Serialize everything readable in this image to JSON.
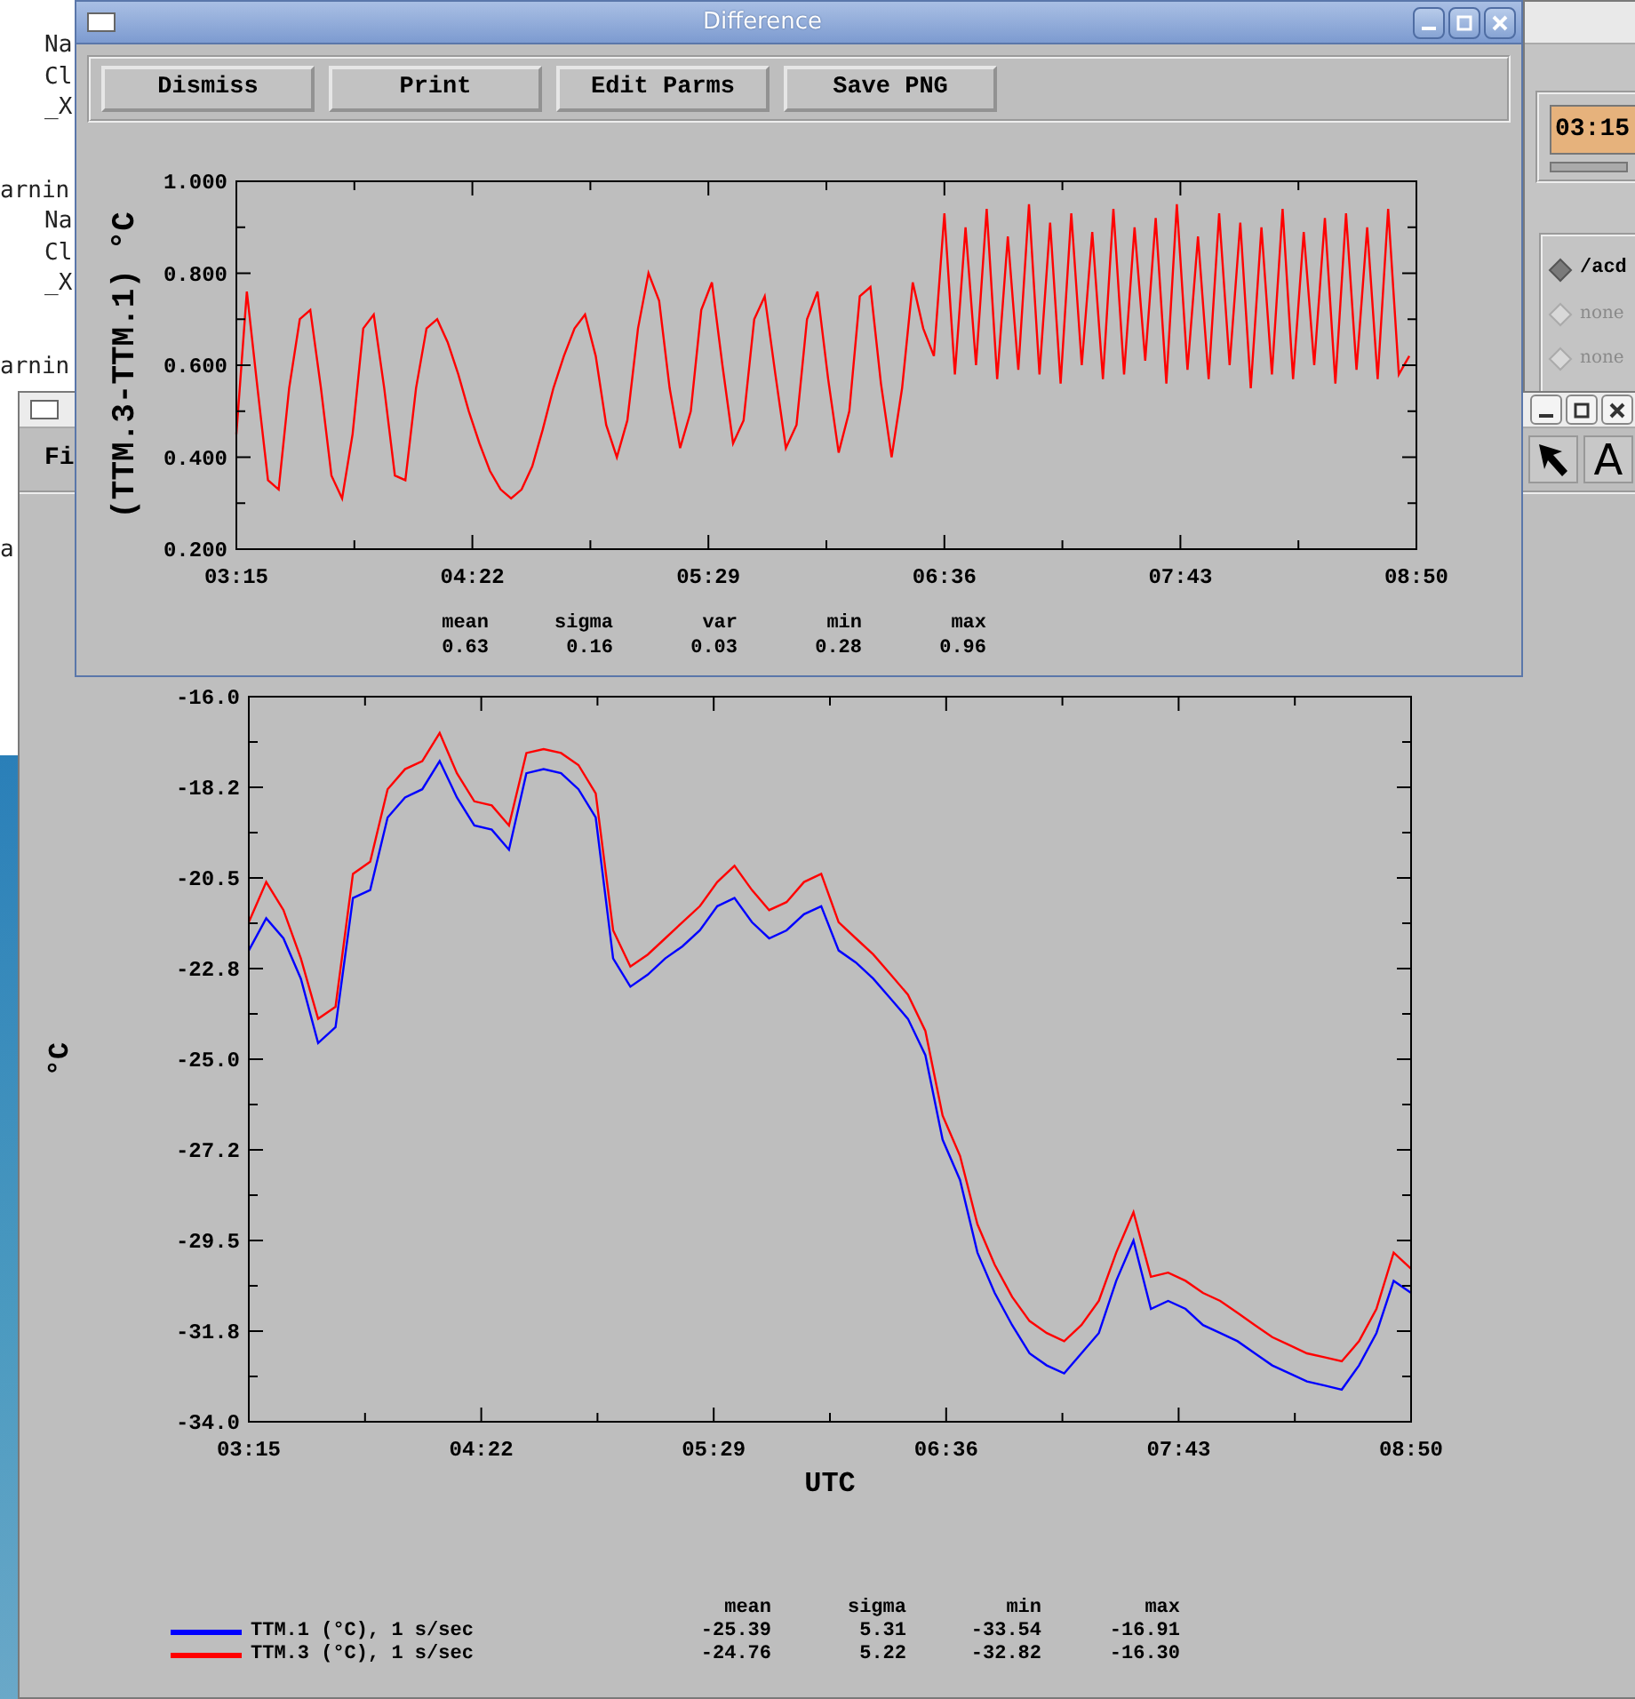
{
  "terminal": {
    "blocks": [
      {
        "lines": [
          "Na",
          "Cl",
          "_X"
        ]
      },
      {
        "heading": "arnin",
        "lines": [
          "Na",
          "Cl",
          "_X"
        ]
      },
      {
        "heading": "arnin"
      },
      {
        "heading": "a"
      }
    ]
  },
  "right_window": {
    "time_field": {
      "value": "03:15"
    },
    "radios": [
      {
        "label": "/acd",
        "selected": true
      },
      {
        "label": "none",
        "selected": false
      },
      {
        "label": "none",
        "selected": false
      }
    ]
  },
  "plot_window": {
    "menu": [
      {
        "label": "Fi"
      }
    ],
    "tools": [
      {
        "kind": "pointer"
      },
      {
        "kind": "text",
        "label": "A"
      }
    ],
    "chart_data": {
      "type": "line",
      "xlabel": "UTC",
      "ylabel": "°C",
      "x": [
        195,
        200,
        205,
        210,
        215,
        220,
        225,
        230,
        235,
        240,
        245,
        250,
        255,
        260,
        265,
        270,
        275,
        280,
        285,
        290,
        295,
        300,
        305,
        310,
        315,
        320,
        325,
        330,
        335,
        340,
        345,
        350,
        355,
        360,
        365,
        370,
        375,
        380,
        385,
        390,
        395,
        400,
        405,
        410,
        415,
        420,
        425,
        430,
        435,
        440,
        445,
        450,
        455,
        460,
        465,
        470,
        475,
        480,
        485,
        490,
        495,
        500,
        505,
        510,
        515,
        520,
        525,
        530
      ],
      "xlim": [
        195,
        530
      ],
      "ylim": [
        -34,
        -16
      ],
      "xticks": [
        {
          "value": 195,
          "label": "03:15"
        },
        {
          "value": 262,
          "label": "04:22"
        },
        {
          "value": 329,
          "label": "05:29"
        },
        {
          "value": 396,
          "label": "06:36"
        },
        {
          "value": 463,
          "label": "07:43"
        },
        {
          "value": 530,
          "label": "08:50"
        }
      ],
      "yticks": [
        {
          "value": -16,
          "label": "-16.0"
        },
        {
          "value": -18.25,
          "label": "-18.2"
        },
        {
          "value": -20.5,
          "label": "-20.5"
        },
        {
          "value": -22.75,
          "label": "-22.8"
        },
        {
          "value": -25,
          "label": "-25.0"
        },
        {
          "value": -27.25,
          "label": "-27.2"
        },
        {
          "value": -29.5,
          "label": "-29.5"
        },
        {
          "value": -31.75,
          "label": "-31.8"
        },
        {
          "value": -34,
          "label": "-34.0"
        }
      ],
      "series": [
        {
          "name": "TTM.1 (°C), 1 s/sec",
          "color": "#0000ff",
          "values": [
            -22.3,
            -21.5,
            -22.0,
            -23.0,
            -24.6,
            -24.2,
            -21.0,
            -20.8,
            -19.0,
            -18.5,
            -18.3,
            -17.6,
            -18.5,
            -19.2,
            -19.3,
            -19.8,
            -17.9,
            -17.8,
            -17.9,
            -18.3,
            -19.0,
            -22.5,
            -23.2,
            -22.9,
            -22.5,
            -22.2,
            -21.8,
            -21.2,
            -21.0,
            -21.6,
            -22.0,
            -21.8,
            -21.4,
            -21.2,
            -22.3,
            -22.6,
            -23.0,
            -23.5,
            -24.0,
            -24.9,
            -27.0,
            -28.0,
            -29.8,
            -30.8,
            -31.6,
            -32.3,
            -32.6,
            -32.8,
            -32.3,
            -31.8,
            -30.5,
            -29.5,
            -31.2,
            -31.0,
            -31.2,
            -31.6,
            -31.8,
            -32.0,
            -32.3,
            -32.6,
            -32.8,
            -33.0,
            -33.1,
            -33.2,
            -32.6,
            -31.8,
            -30.5,
            -30.8
          ]
        },
        {
          "name": "TTM.3 (°C), 1 s/sec",
          "color": "#ff0000",
          "values": [
            -21.6,
            -20.6,
            -21.3,
            -22.5,
            -24.0,
            -23.7,
            -20.4,
            -20.1,
            -18.3,
            -17.8,
            -17.6,
            -16.9,
            -17.9,
            -18.6,
            -18.7,
            -19.2,
            -17.4,
            -17.3,
            -17.4,
            -17.7,
            -18.4,
            -21.8,
            -22.7,
            -22.4,
            -22.0,
            -21.6,
            -21.2,
            -20.6,
            -20.2,
            -20.8,
            -21.3,
            -21.1,
            -20.6,
            -20.4,
            -21.6,
            -22.0,
            -22.4,
            -22.9,
            -23.4,
            -24.3,
            -26.4,
            -27.4,
            -29.1,
            -30.1,
            -30.9,
            -31.5,
            -31.8,
            -32.0,
            -31.6,
            -31.0,
            -29.8,
            -28.8,
            -30.4,
            -30.3,
            -30.5,
            -30.8,
            -31.0,
            -31.3,
            -31.6,
            -31.9,
            -32.1,
            -32.3,
            -32.4,
            -32.5,
            -32.0,
            -31.2,
            -29.8,
            -30.2
          ]
        }
      ]
    },
    "stats": {
      "columns": [
        "mean",
        "sigma",
        "min",
        "max"
      ],
      "rows": [
        [
          "-25.39",
          "5.31",
          "-33.54",
          "-16.91"
        ],
        [
          "-24.76",
          "5.22",
          "-32.82",
          "-16.30"
        ]
      ]
    }
  },
  "difference_window": {
    "title": "Difference",
    "buttons": [
      "Dismiss",
      "Print",
      "Edit Parms",
      "Save PNG"
    ],
    "chart_data": {
      "type": "line",
      "ylabel": "(TTM.3-TTM.1) °C",
      "x": [
        195,
        198,
        201,
        204,
        207,
        210,
        213,
        216,
        219,
        222,
        225,
        228,
        231,
        234,
        237,
        240,
        243,
        246,
        249,
        252,
        255,
        258,
        261,
        264,
        267,
        270,
        273,
        276,
        279,
        282,
        285,
        288,
        291,
        294,
        297,
        300,
        303,
        306,
        309,
        312,
        315,
        318,
        321,
        324,
        327,
        330,
        333,
        336,
        339,
        342,
        345,
        348,
        351,
        354,
        357,
        360,
        363,
        366,
        369,
        372,
        375,
        378,
        381,
        384,
        387,
        390,
        393,
        396,
        399,
        402,
        405,
        408,
        411,
        414,
        417,
        420,
        423,
        426,
        429,
        432,
        435,
        438,
        441,
        444,
        447,
        450,
        453,
        456,
        459,
        462,
        465,
        468,
        471,
        474,
        477,
        480,
        483,
        486,
        489,
        492,
        495,
        498,
        501,
        504,
        507,
        510,
        513,
        516,
        519,
        522,
        525,
        528
      ],
      "xlim": [
        195,
        530
      ],
      "ylim": [
        0.2,
        1.0
      ],
      "xticks": [
        {
          "value": 195,
          "label": "03:15"
        },
        {
          "value": 262,
          "label": "04:22"
        },
        {
          "value": 329,
          "label": "05:29"
        },
        {
          "value": 396,
          "label": "06:36"
        },
        {
          "value": 463,
          "label": "07:43"
        },
        {
          "value": 530,
          "label": "08:50"
        }
      ],
      "yticks": [
        {
          "value": 0.2,
          "label": "0.200"
        },
        {
          "value": 0.4,
          "label": "0.400"
        },
        {
          "value": 0.6,
          "label": "0.600"
        },
        {
          "value": 0.8,
          "label": "0.800"
        },
        {
          "value": 1.0,
          "label": "1.000"
        }
      ],
      "series": [
        {
          "color": "#ff0000",
          "values": [
            0.45,
            0.76,
            0.55,
            0.35,
            0.33,
            0.55,
            0.7,
            0.72,
            0.55,
            0.36,
            0.31,
            0.45,
            0.68,
            0.71,
            0.55,
            0.36,
            0.35,
            0.55,
            0.68,
            0.7,
            0.65,
            0.58,
            0.5,
            0.43,
            0.37,
            0.33,
            0.31,
            0.33,
            0.38,
            0.46,
            0.55,
            0.62,
            0.68,
            0.71,
            0.62,
            0.47,
            0.4,
            0.48,
            0.68,
            0.8,
            0.74,
            0.55,
            0.42,
            0.5,
            0.72,
            0.78,
            0.6,
            0.43,
            0.48,
            0.7,
            0.75,
            0.58,
            0.42,
            0.47,
            0.7,
            0.76,
            0.57,
            0.41,
            0.5,
            0.75,
            0.77,
            0.56,
            0.4,
            0.55,
            0.78,
            0.68,
            0.62,
            0.93,
            0.58,
            0.9,
            0.6,
            0.94,
            0.57,
            0.88,
            0.59,
            0.95,
            0.58,
            0.91,
            0.56,
            0.93,
            0.6,
            0.89,
            0.57,
            0.94,
            0.58,
            0.9,
            0.61,
            0.92,
            0.56,
            0.95,
            0.59,
            0.88,
            0.57,
            0.93,
            0.6,
            0.91,
            0.55,
            0.9,
            0.58,
            0.94,
            0.57,
            0.89,
            0.6,
            0.92,
            0.56,
            0.93,
            0.59,
            0.9,
            0.57,
            0.94,
            0.58,
            0.62
          ]
        }
      ]
    },
    "stats": {
      "columns": [
        "mean",
        "sigma",
        "var",
        "min",
        "max"
      ],
      "values": [
        "0.63",
        "0.16",
        "0.03",
        "0.28",
        "0.96"
      ]
    }
  }
}
